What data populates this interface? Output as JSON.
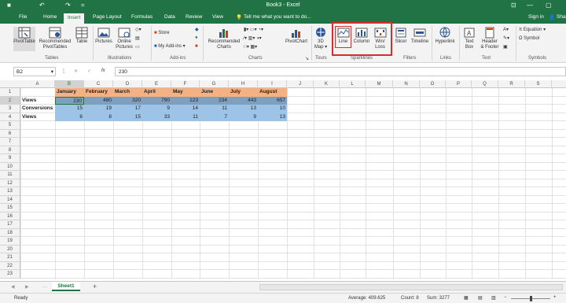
{
  "window": {
    "title": "Book3 - Excel",
    "min_glyph": "—",
    "restore_glyph": "▢",
    "close_glyph": "✕",
    "ribbon_toggle_glyph": "⊡"
  },
  "qat": {
    "save_glyph": "■",
    "undo_glyph": "↶",
    "redo_glyph": "↷",
    "more_glyph": "="
  },
  "tabs": [
    "File",
    "Home",
    "Insert",
    "Page Layout",
    "Formulas",
    "Data",
    "Review",
    "View"
  ],
  "tell_me": "Tell me what you want to do...",
  "account": {
    "sign_in": "Sign in",
    "share": "Sha"
  },
  "ribbon": {
    "tables": {
      "group": "Tables",
      "pivot": "PivotTable",
      "recommended_1": "Recommended",
      "recommended_2": "PivotTables",
      "table": "Table"
    },
    "illustrations": {
      "group": "Illustrations",
      "pictures": "Pictures",
      "online_1": "Online",
      "online_2": "Pictures"
    },
    "addins": {
      "group": "Add-ins",
      "store": "Store",
      "my_addins": "My Add-ins"
    },
    "charts": {
      "group": "Charts",
      "rec_1": "Recommended",
      "rec_2": "Charts",
      "pivotchart": "PivotChart"
    },
    "tours": {
      "group": "Tours",
      "map_1": "3D",
      "map_2": "Map"
    },
    "sparklines": {
      "group": "Sparklines",
      "line": "Line",
      "column": "Column",
      "winloss_1": "Win/",
      "winloss_2": "Loss"
    },
    "filters": {
      "group": "Filters",
      "slicer": "Slicer",
      "timeline": "Timeline"
    },
    "links": {
      "group": "Links",
      "hyperlink": "Hyperlink"
    },
    "text": {
      "group": "Text",
      "textbox_1": "Text",
      "textbox_2": "Box",
      "hf_1": "Header",
      "hf_2": "& Footer"
    },
    "symbols": {
      "group": "Symbols",
      "equation": "Equation",
      "symbol": "Symbol"
    }
  },
  "formula_bar": {
    "name_box": "B2",
    "fx": "fx",
    "cancel": "✕",
    "enter": "✓",
    "value": "230"
  },
  "columns": [
    "A",
    "B",
    "C",
    "D",
    "E",
    "F",
    "G",
    "H",
    "I",
    "J",
    "K",
    "L",
    "M",
    "N",
    "O",
    "P",
    "Q",
    "R",
    "S"
  ],
  "rows": [
    1,
    2,
    3,
    4,
    5,
    6,
    7,
    8,
    9,
    10,
    11,
    12,
    13,
    14,
    15,
    16,
    17,
    18,
    19,
    20,
    21,
    22,
    23
  ],
  "sheet": {
    "headers": [
      "January",
      "February",
      "March",
      "April",
      "May",
      "June",
      "July",
      "August"
    ],
    "data": [
      {
        "label": "Views",
        "values": [
          230,
          480,
          320,
          790,
          123,
          234,
          443,
          657
        ]
      },
      {
        "label": "Conversions",
        "values": [
          15,
          19,
          17,
          9,
          14,
          11,
          13,
          10
        ]
      },
      {
        "label": "Views",
        "values": [
          6,
          8,
          15,
          33,
          11,
          7,
          9,
          13
        ]
      }
    ]
  },
  "sheet_tabs": {
    "active": "Sheet1",
    "add": "+",
    "prev": "◀",
    "next": "▶",
    "more": "…"
  },
  "status": {
    "ready": "Ready",
    "average": "Average: 409.625",
    "count": "Count: 8",
    "sum": "Sum: 3277"
  },
  "colors": {
    "accent": "#217346",
    "header_fill": "#f4b183",
    "data_fill": "#9dc3e6",
    "highlight": "#d32f2f"
  }
}
